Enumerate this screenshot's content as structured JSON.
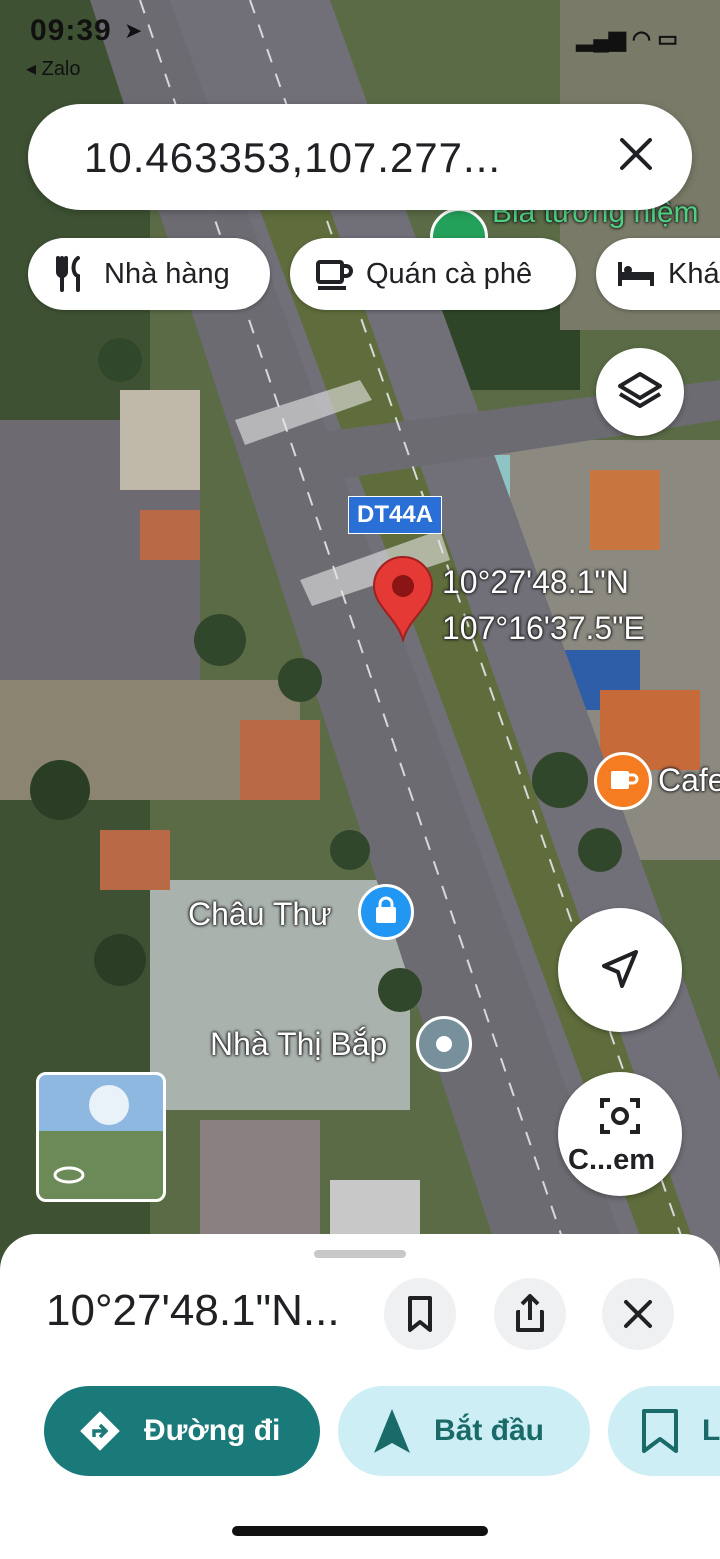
{
  "status_bar": {
    "time": "09:39",
    "back_label": "◂ Zalo"
  },
  "search": {
    "query": "10.463353,107.277..."
  },
  "chips": [
    {
      "label": "Nhà hàng",
      "icon": "restaurant-icon"
    },
    {
      "label": "Quán cà phê",
      "icon": "coffee-icon"
    },
    {
      "label": "Khá",
      "icon": "hotel-icon"
    }
  ],
  "map": {
    "road_label": "DT44A",
    "pin_lat": "10°27'48.1\"N",
    "pin_lng": "107°16'37.5\"E",
    "poi_chau_thu": "Châu Thư",
    "poi_nha_thi_bap": "Nhà Thị Bắp",
    "poi_cafe": "Cafe",
    "memorial_label": "Bia tưởng niệm"
  },
  "controls": {
    "camera_label": "C...em"
  },
  "sheet": {
    "title": "10°27'48.1\"N...",
    "directions_label": "Đường đi",
    "start_label": "Bắt đầu",
    "save_label": "L"
  },
  "colors": {
    "primary": "#1a7a7a",
    "light_accent": "#cdeef5",
    "pin": "#e53935"
  }
}
